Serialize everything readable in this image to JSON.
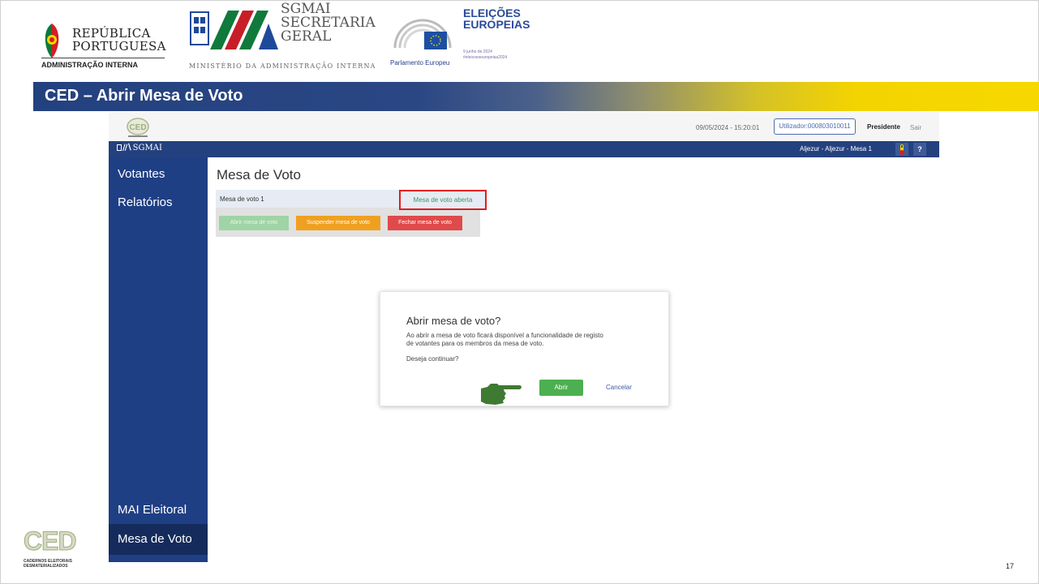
{
  "header": {
    "rp_line1": "REPÚBLICA",
    "rp_line2": "PORTUGUESA",
    "rp_sub": "ADMINISTRAÇÃO INTERNA",
    "sg_line1": "SGMAI",
    "sg_line2": "SECRETARIA",
    "sg_line3": "GERAL",
    "sg_ministry": "MINISTÉRIO DA ADMINISTRAÇÃO INTERNA",
    "pe_label": "Parlamento Europeu",
    "ee_line1": "ELEIÇÕES",
    "ee_line2": "EUROPEIAS",
    "ee_date1": "9 junho de 2024",
    "ee_date2": "#eleicoeseuropeias2024"
  },
  "banner": {
    "title": "CED – Abrir Mesa de Voto",
    "gradient": [
      "#24417f",
      "#f6d800"
    ]
  },
  "app": {
    "datetime": "09/05/2024 - 15:20:01",
    "user": "Utilizador:000803010011",
    "role": "Presidente",
    "logout": "Sair",
    "brand": "SGMAI",
    "location": "Aljezur - Aljezur - Mesa 1",
    "help": "?",
    "sidebar": {
      "votantes": "Votantes",
      "relatorios": "Relatórios",
      "mai": "MAI Eleitoral",
      "mesa": "Mesa de Voto"
    },
    "page_title": "Mesa de Voto",
    "mesa_label": "Mesa de voto 1",
    "mesa_status": "Mesa de voto aberta",
    "btn_open": "Abrir mesa de voto",
    "btn_suspend": "Suspender mesa de voto",
    "btn_close": "Fechar mesa de voto",
    "colors": {
      "nav": "#24417f",
      "sidebar": "#1f3f84",
      "open": "#4caf50",
      "suspend": "#f0a020",
      "close": "#e04a4a",
      "highlight": "#e21b1b"
    }
  },
  "dialog": {
    "title": "Abrir mesa de voto?",
    "body_line1": "Ao abrir a mesa de voto ficará disponível a funcionalidade de registo",
    "body_line2": "de votantes para os membros da mesa de voto.",
    "question": "Deseja continuar?",
    "confirm": "Abrir",
    "cancel": "Cancelar"
  },
  "footer": {
    "ced": "CED",
    "ced_sub1": "CADERNOS ELEITORAIS",
    "ced_sub2": "DESMATERIALIZADOS",
    "page_number": "17"
  },
  "icons": [
    "portugal-flag-icon",
    "sgmai-logo-icon",
    "european-parliament-icon",
    "eu-flag-icon",
    "help-icon",
    "pointing-hand-icon",
    "ced-logo-icon"
  ]
}
